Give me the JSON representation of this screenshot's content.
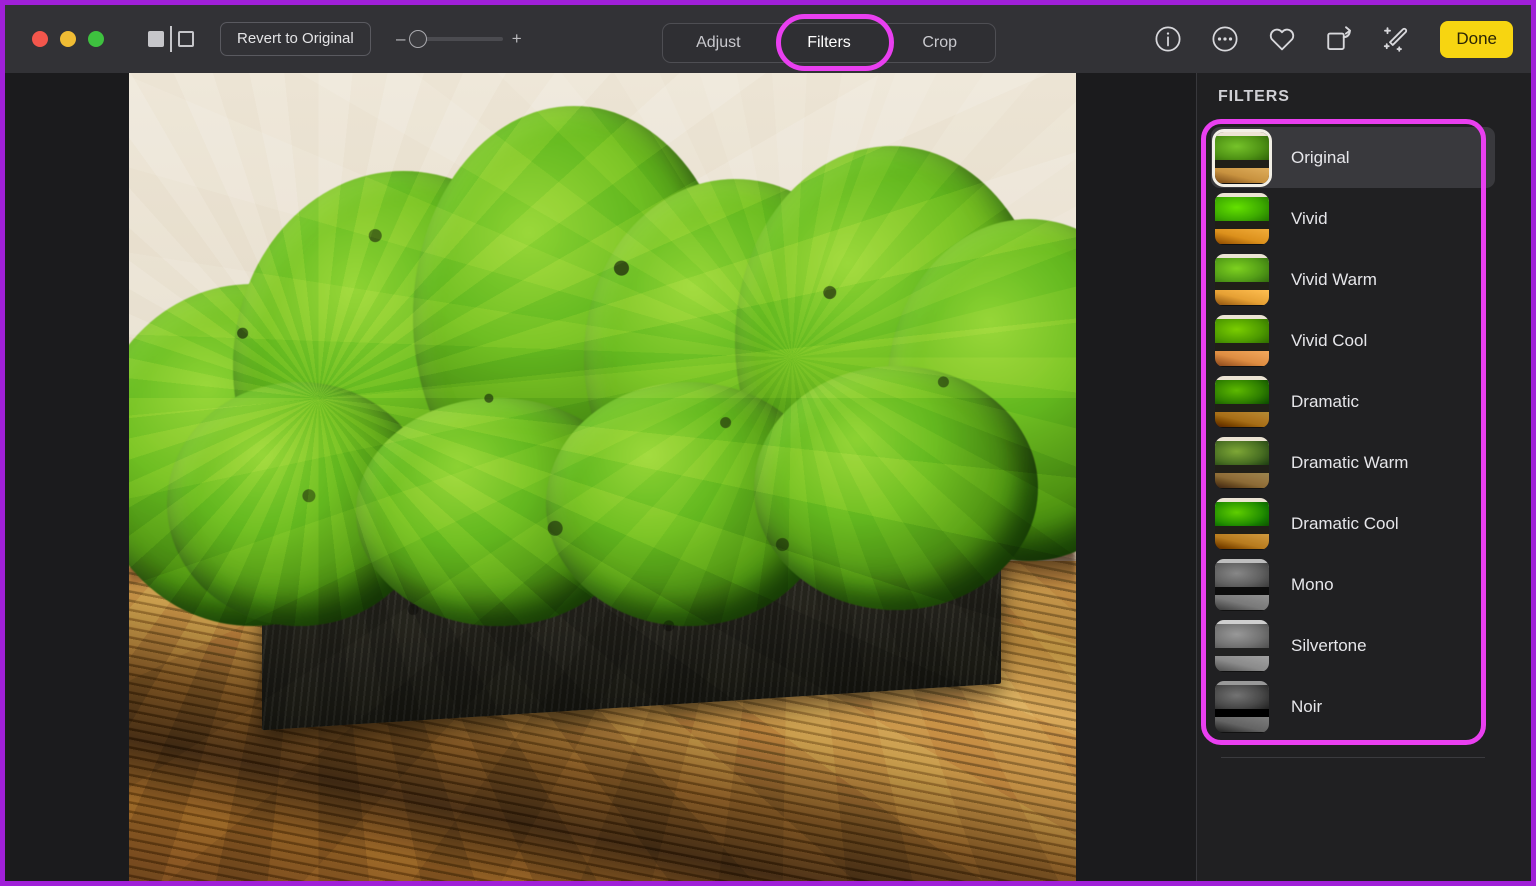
{
  "app": {
    "window_controls": [
      "close",
      "minimize",
      "maximize"
    ],
    "compare_icon": "compare-split-icon"
  },
  "toolbar": {
    "revert_label": "Revert to Original",
    "zoom": {
      "minus_label": "–",
      "plus_label": "+",
      "value_percent": 10
    },
    "segments": [
      {
        "label": "Adjust",
        "active": false
      },
      {
        "label": "Filters",
        "active": true
      },
      {
        "label": "Crop",
        "active": false
      }
    ],
    "right_icons": [
      {
        "name": "info-icon",
        "glyph": "info"
      },
      {
        "name": "more-icon",
        "glyph": "ellipsis"
      },
      {
        "name": "heart-icon",
        "glyph": "heart"
      },
      {
        "name": "rotate-icon",
        "glyph": "rotate"
      },
      {
        "name": "auto-enhance-icon",
        "glyph": "magic-wand"
      }
    ],
    "done_label": "Done"
  },
  "sidebar": {
    "title": "FILTERS",
    "filters": [
      {
        "label": "Original",
        "variant": "v-orig",
        "selected": true
      },
      {
        "label": "Vivid",
        "variant": "v-vivid",
        "selected": false
      },
      {
        "label": "Vivid Warm",
        "variant": "v-vividwarm",
        "selected": false
      },
      {
        "label": "Vivid Cool",
        "variant": "v-vividcool",
        "selected": false
      },
      {
        "label": "Dramatic",
        "variant": "v-dramatic",
        "selected": false
      },
      {
        "label": "Dramatic Warm",
        "variant": "v-dramwarm",
        "selected": false
      },
      {
        "label": "Dramatic Cool",
        "variant": "v-dramcool",
        "selected": false
      },
      {
        "label": "Mono",
        "variant": "v-mono",
        "selected": false
      },
      {
        "label": "Silvertone",
        "variant": "v-silver",
        "selected": false
      },
      {
        "label": "Noir",
        "variant": "v-noir",
        "selected": false
      }
    ]
  },
  "photo": {
    "subject": "green reindeer moss in a dark rectangular planter on a wooden table",
    "background_color": "#e9e1d2"
  },
  "annotations": {
    "highlight_color": "#e93ff0",
    "frame_color": "#a020d8",
    "targets": [
      "filters-tab",
      "filters-list"
    ]
  },
  "colors": {
    "toolbar_bg": "#323236",
    "canvas_bg": "#1b1b1d",
    "sidebar_bg": "#202022",
    "selected_row_bg": "#39393d",
    "done_button_bg": "#f7d511",
    "traffic_red": "#f3564c",
    "traffic_yellow": "#f0bc34",
    "traffic_green": "#3ec13f"
  }
}
